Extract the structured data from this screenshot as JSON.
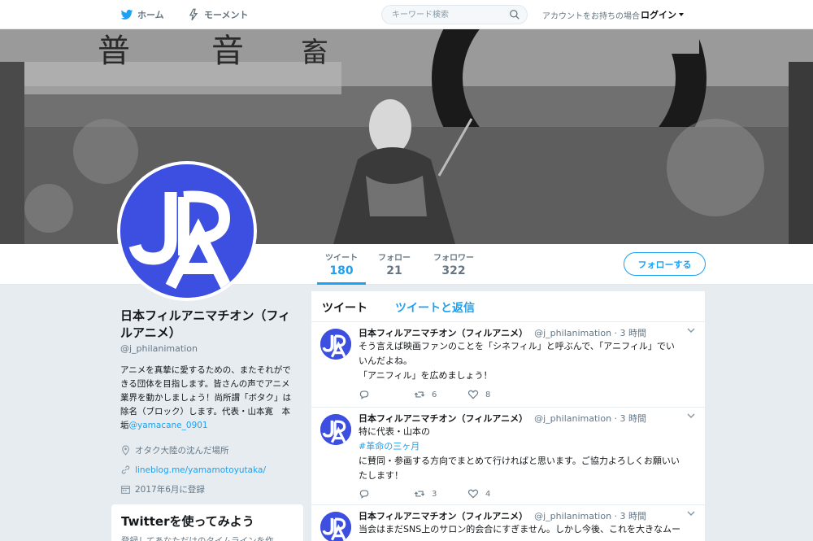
{
  "nav": {
    "home_label": "ホーム",
    "moments_label": "モーメント",
    "search_placeholder": "キーワード検索",
    "login_prompt": "アカウントをお持ちの場合",
    "login_label": "ログイン"
  },
  "profile": {
    "name": "日本フィルアニマチオン（フィルアニメ）",
    "handle": "@j_philanimation",
    "bio": "アニメを真摯に愛するための、またそれができる団体を目指します。皆さんの声でアニメ業界を動かしましょう！尚所謂「ボタク」は除名（ブロック）します。代表・山本寛　本垢",
    "bio_link": "@yamacane_0901",
    "location": "オタク大陸の沈んだ場所",
    "url": "lineblog.me/yamamotoyutaka/",
    "joined": "2017年6月に登録",
    "logo_text": "JPA"
  },
  "stats": [
    {
      "label": "ツイート",
      "value": "180"
    },
    {
      "label": "フォロー",
      "value": "21"
    },
    {
      "label": "フォロワー",
      "value": "322"
    }
  ],
  "follow_label": "フォローする",
  "tabs": {
    "tweets": "ツイート",
    "replies": "ツイートと返信"
  },
  "tweets": [
    {
      "name": "日本フィルアニマチオン（フィルアニメ）",
      "handle": "@j_philanimation · 3 時間",
      "line1": "そう言えば映画ファンのことを「シネフィル」と呼ぶんで、「アニフィル」でい",
      "line2": "いんだよね。",
      "line3": "「アニフィル」を広めましょう！",
      "retweets": "6",
      "likes": "8"
    },
    {
      "name": "日本フィルアニマチオン（フィルアニメ）",
      "handle": "@j_philanimation · 3 時間",
      "line1": "特に代表・山本の",
      "hashtag": "#革命の三ヶ月",
      "line3": "に賛同・参画する方向でまとめて行ければと思います。ご協力よろしくお願いい",
      "line4": "たします！",
      "retweets": "3",
      "likes": "4"
    },
    {
      "name": "日本フィルアニマチオン（フィルアニメ）",
      "handle": "@j_philanimation · 3 時間",
      "line1": "当会はまだSNS上のサロン的会合にすぎません。しかし今後、これを大きなムー"
    }
  ],
  "try_card": {
    "title": "Twitterを使ってみよう",
    "subtitle": "登録してあなただけのタイムラインを作"
  },
  "colors": {
    "accent": "#1da1f2",
    "logo_blue": "#3d4fe0"
  }
}
